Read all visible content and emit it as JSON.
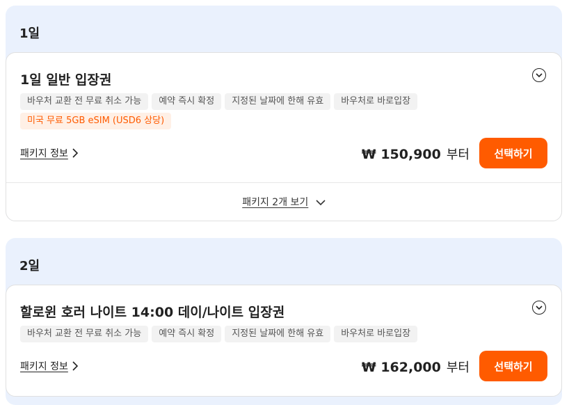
{
  "groups": [
    {
      "title": "1일",
      "card": {
        "name": "1일 일반 입장권",
        "tags": [
          "바우처 교환 전 무료 취소 가능",
          "예약 즉시 확정",
          "지정된 날짜에 한해 유효",
          "바우처로 바로입장"
        ],
        "promo": "미국 무료 5GB eSIM (USD6 상당)",
        "package_info": "패키지 정보",
        "price": "₩ 150,900",
        "price_suffix": "부터",
        "select": "선택하기",
        "more": "패키지 2개 보기"
      }
    },
    {
      "title": "2일",
      "card": {
        "name": "할로윈 호러 나이트 14:00 데이/나이트 입장권",
        "tags": [
          "바우처 교환 전 무료 취소 가능",
          "예약 즉시 확정",
          "지정된 날짜에 한해 유효",
          "바우처로 바로입장"
        ],
        "package_info": "패키지 정보",
        "price": "₩ 162,000",
        "price_suffix": "부터",
        "select": "선택하기"
      }
    }
  ],
  "colors": {
    "accent": "#ff5b00",
    "group_bg": "#eaf1fd",
    "tag_bg": "#f2f2f2",
    "promo_bg": "#fff0e6"
  }
}
